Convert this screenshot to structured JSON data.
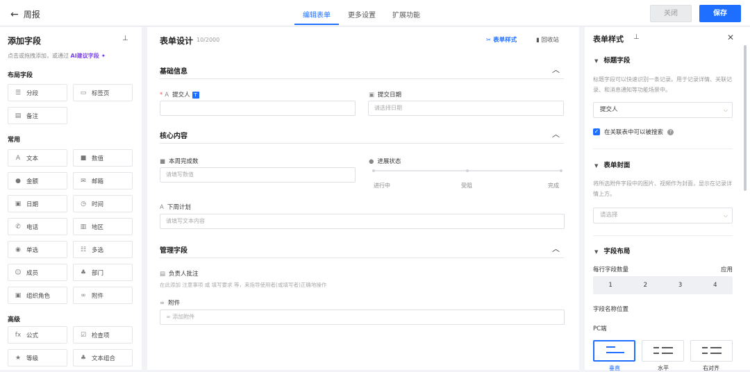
{
  "topbar": {
    "back_label": "周报",
    "tabs": [
      "编辑表单",
      "更多设置",
      "扩展功能"
    ],
    "close_label": "关闭",
    "save_label": "保存"
  },
  "left": {
    "title": "添加字段",
    "hint_prefix": "点击或拖拽添加，或通过",
    "hint_ai": "AI建议字段",
    "groups": {
      "layout": "布局字段",
      "common": "常用",
      "advanced": "高级"
    },
    "layout_fields": [
      "分段",
      "标签页",
      "备注"
    ],
    "common_fields": [
      "文本",
      "数值",
      "金额",
      "邮箱",
      "日期",
      "时间",
      "电话",
      "地区",
      "单选",
      "多选",
      "成员",
      "部门",
      "组织角色",
      "附件"
    ],
    "advanced_fields": [
      "公式",
      "检查项",
      "等级",
      "文本组合"
    ]
  },
  "center": {
    "title": "表单设计",
    "count": "10/2000",
    "style_label": "表单样式",
    "recycle_label": "回收站",
    "sections": [
      "基础信息",
      "核心内容",
      "管理字段"
    ],
    "fields": {
      "submitter": "提交人",
      "submit_date": "提交日期",
      "submit_date_placeholder": "请选择日期",
      "weekly_count": "本周完成数",
      "weekly_count_placeholder": "请填写数值",
      "progress": "进展状态",
      "progress_options": [
        "进行中",
        "受阻",
        "完成"
      ],
      "next_plan": "下周计划",
      "next_plan_placeholder": "请填写文本内容",
      "manager_note": "负责人批注",
      "manager_note_help": "在此添加 注意事项 或 填写要求 等，来指导使用者(或填写者)正确地操作",
      "attachment": "附件",
      "attachment_placeholder": "添加附件"
    }
  },
  "right": {
    "title": "表单样式",
    "title_field_section": "标题字段",
    "title_field_desc": "标题字段可以快速识别一条记录。用于记录详情、关联记录、和消息通知等功能场景中。",
    "title_field_value": "提交人",
    "searchable_label": "在关联表中可以被搜索",
    "cover_section": "表单封面",
    "cover_desc": "将所选附件字段中的图片、视频作为封面，显示在记录详情上方。",
    "cover_placeholder": "请选择",
    "layout_section": "字段布局",
    "per_row_label": "每行字段数量",
    "apply_label": "应用",
    "per_row_options": [
      "1",
      "2",
      "3",
      "4"
    ],
    "name_position_label": "字段名称位置",
    "pc_label": "PC端",
    "positions": [
      "垂直",
      "水平",
      "右对齐"
    ]
  },
  "colors": {
    "accent": "#1e6fff",
    "ai": "#7b3ff2",
    "required": "#e34d59"
  }
}
